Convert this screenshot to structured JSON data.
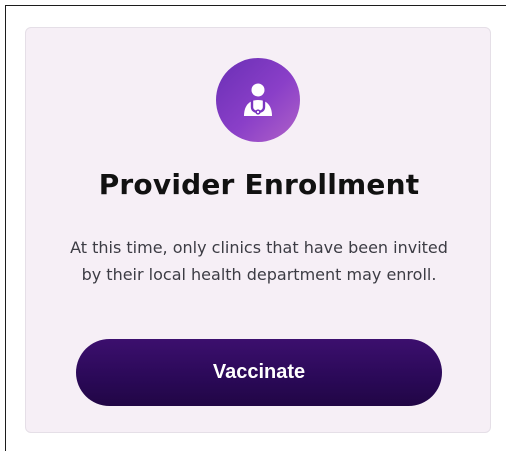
{
  "card": {
    "icon": "doctor-icon",
    "title": "Provider Enrollment",
    "description": "At this time, only clinics that have been invited by their local health department may enroll.",
    "button_label": "Vaccinate"
  },
  "colors": {
    "card_background": "#f6eff6",
    "icon_gradient_start": "#6a2fb5",
    "icon_gradient_end": "#b062c8",
    "button_background": "#2a0957",
    "title_text": "#111111",
    "body_text": "#3c3c44"
  }
}
